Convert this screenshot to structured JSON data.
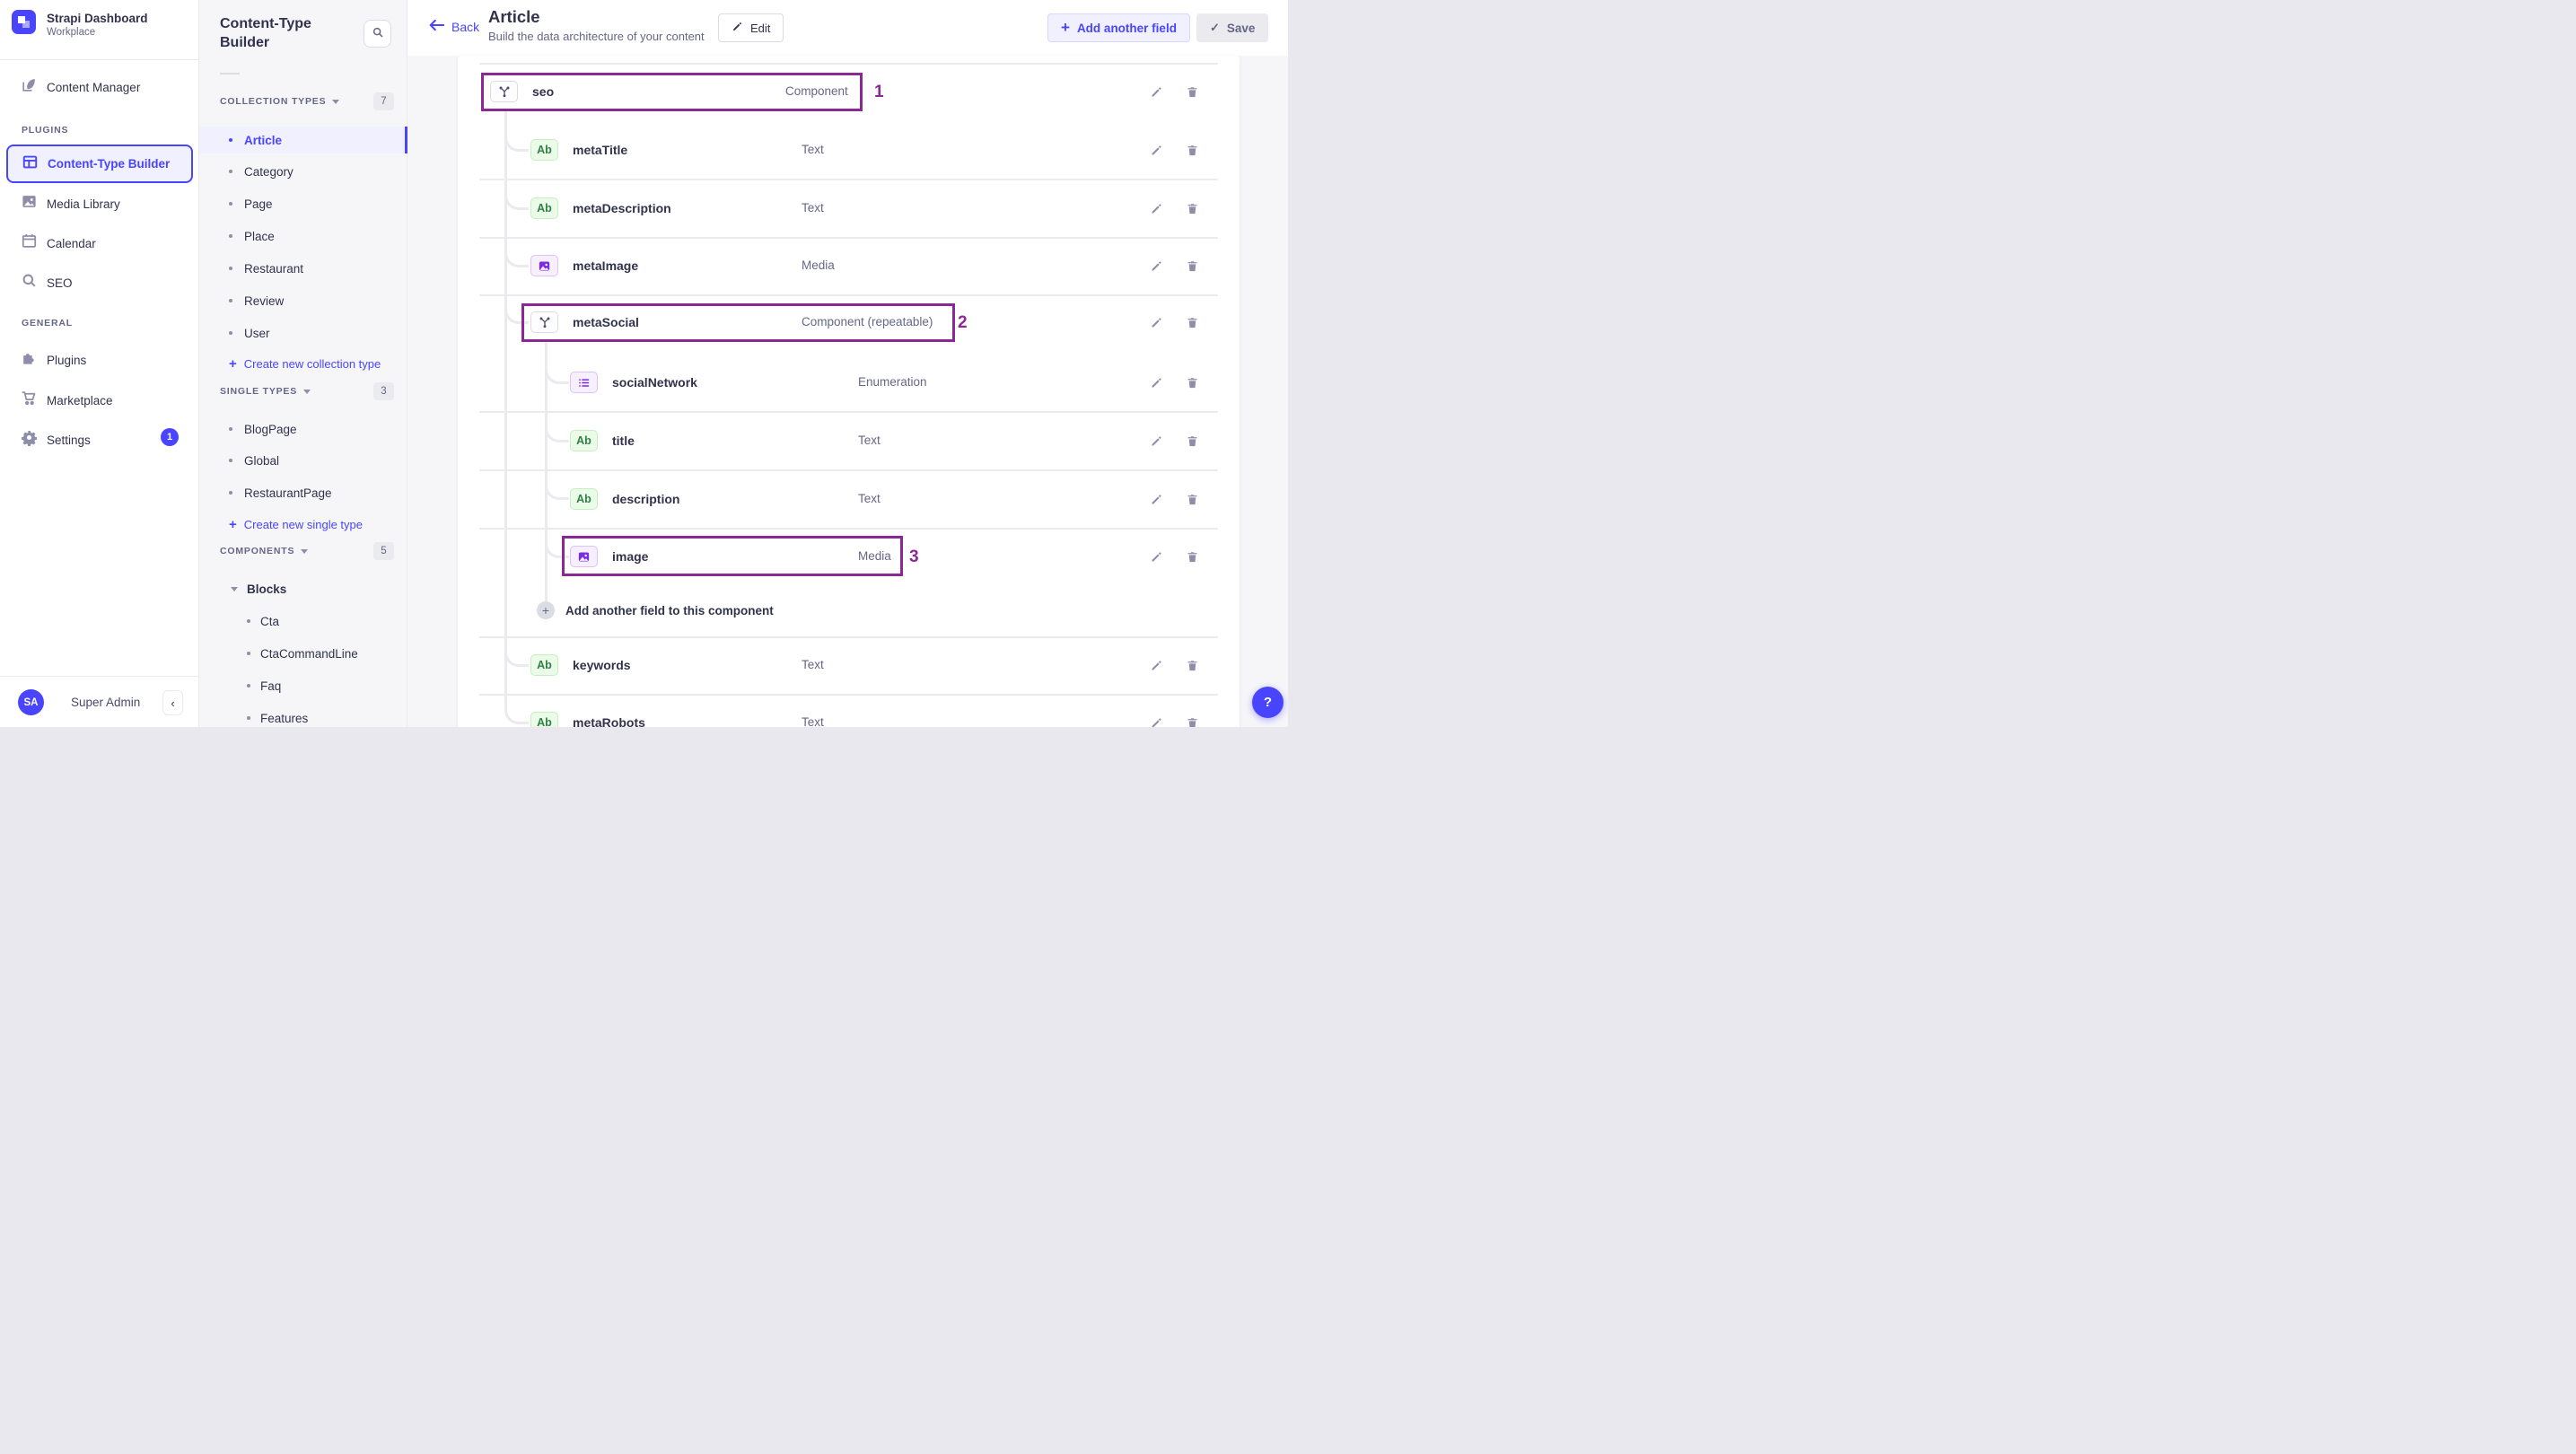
{
  "brand": {
    "app_title": "Strapi Dashboard",
    "workspace": "Workplace",
    "avatar_initials": "SA",
    "user_name": "Super Admin"
  },
  "nav": {
    "content_manager": "Content Manager",
    "plugins_section": "PLUGINS",
    "items_plugins": [
      {
        "label": "Content-Type Builder",
        "active": true
      },
      {
        "label": "Media Library"
      },
      {
        "label": "Calendar"
      },
      {
        "label": "SEO"
      }
    ],
    "general_section": "GENERAL",
    "items_general": [
      {
        "label": "Plugins"
      },
      {
        "label": "Marketplace"
      },
      {
        "label": "Settings",
        "badge": "1"
      }
    ]
  },
  "builder_panel": {
    "title": "Content-Type Builder",
    "collection_header": "COLLECTION TYPES",
    "collection_count": "7",
    "collection_items": [
      "Article",
      "Category",
      "Page",
      "Place",
      "Restaurant",
      "Review",
      "User"
    ],
    "create_collection": "Create new collection type",
    "single_header": "SINGLE TYPES",
    "single_count": "3",
    "single_items": [
      "BlogPage",
      "Global",
      "RestaurantPage"
    ],
    "create_single": "Create new single type",
    "components_header": "COMPONENTS",
    "components_count": "5",
    "component_group": "Blocks",
    "component_items": [
      "Cta",
      "CtaCommandLine",
      "Faq",
      "Features"
    ]
  },
  "header": {
    "back": "Back",
    "title": "Article",
    "subtitle": "Build the data architecture of your content",
    "edit": "Edit",
    "add_field": "Add another field",
    "save": "Save"
  },
  "fields": {
    "rows": [
      {
        "name": "seo",
        "type": "Component",
        "badge": "component",
        "level": 0,
        "annotation": "1"
      },
      {
        "name": "metaTitle",
        "type": "Text",
        "badge": "text",
        "level": 1
      },
      {
        "name": "metaDescription",
        "type": "Text",
        "badge": "text",
        "level": 1
      },
      {
        "name": "metaImage",
        "type": "Media",
        "badge": "media",
        "level": 1
      },
      {
        "name": "metaSocial",
        "type": "Component (repeatable)",
        "badge": "component",
        "level": 1,
        "annotation": "2"
      },
      {
        "name": "socialNetwork",
        "type": "Enumeration",
        "badge": "enumeration",
        "level": 2
      },
      {
        "name": "title",
        "type": "Text",
        "badge": "text",
        "level": 2
      },
      {
        "name": "description",
        "type": "Text",
        "badge": "text",
        "level": 2
      },
      {
        "name": "image",
        "type": "Media",
        "badge": "media",
        "level": 2,
        "annotation": "3"
      },
      {
        "name": "keywords",
        "type": "Text",
        "badge": "text",
        "level": 1
      },
      {
        "name": "metaRobots",
        "type": "Text",
        "badge": "text",
        "level": 1
      }
    ],
    "badge_text_glyph": "Ab",
    "add_component_field": "Add another field to this component"
  },
  "help": {
    "label": "?"
  },
  "colors": {
    "accent": "#4945ff",
    "annotation": "#8c2896",
    "text_dark": "#32324d",
    "text_muted": "#666687",
    "type_text_green": "#328048",
    "type_media_purple": "#7d2ae8"
  }
}
